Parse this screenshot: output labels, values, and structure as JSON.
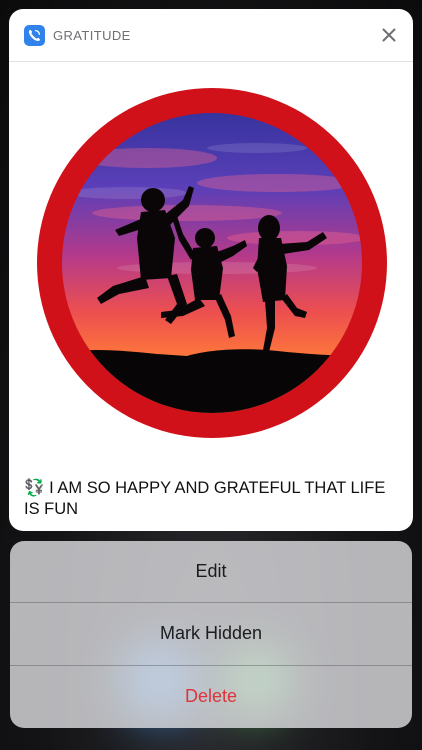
{
  "notification": {
    "app_name": "GRATITUDE",
    "app_icon": "phone-swirl-icon",
    "close_icon": "close-icon",
    "caption": "💱 I AM SO HAPPY AND GRATEFUL THAT LIFE IS FUN",
    "image": {
      "subject": "three people jumping silhouetted against sunset sky",
      "ring_color": "#d0111a"
    }
  },
  "actions": [
    {
      "label": "Edit",
      "style": "default"
    },
    {
      "label": "Mark Hidden",
      "style": "default"
    },
    {
      "label": "Delete",
      "style": "destructive",
      "color": "#e0323a"
    }
  ],
  "colors": {
    "accent": "#2f83ea",
    "destructive": "#e0323a"
  }
}
